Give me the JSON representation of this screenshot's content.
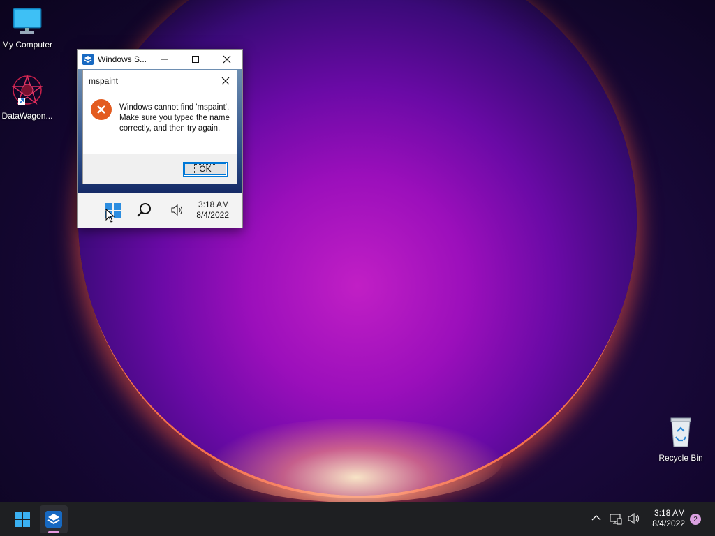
{
  "desktop": {
    "icons": [
      {
        "label": "My Computer",
        "icon": "monitor-icon"
      },
      {
        "label": "DataWagon...",
        "icon": "datawagon-icon"
      },
      {
        "label": "Recycle Bin",
        "icon": "recycle-bin-icon"
      }
    ]
  },
  "window": {
    "title": "Windows S...",
    "controls": [
      "minimize",
      "maximize",
      "close"
    ],
    "inner_taskbar": {
      "time": "3:18 AM",
      "date": "8/4/2022"
    }
  },
  "dialog": {
    "title": "mspaint",
    "message": "Windows cannot find 'mspaint'. Make sure you typed the name correctly, and then try again.",
    "ok_label": "OK"
  },
  "taskbar": {
    "time": "3:18 AM",
    "date": "8/4/2022",
    "notification_count": "2",
    "accent_color": "#0078d7"
  }
}
